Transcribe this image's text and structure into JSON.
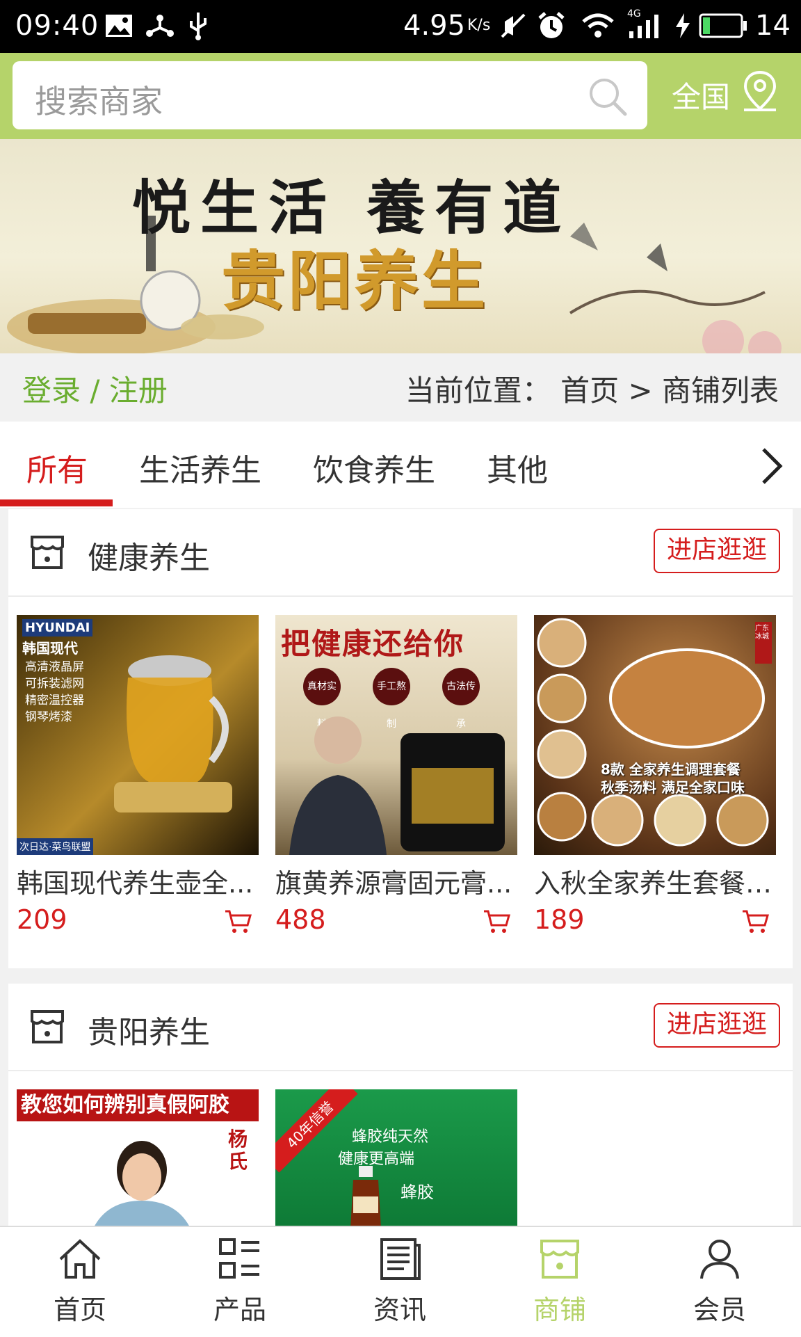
{
  "status_bar": {
    "time": "09:40",
    "net_speed": "4.95",
    "net_unit": "K/s",
    "battery": "14",
    "signal_label": "4G"
  },
  "search": {
    "placeholder": "搜索商家",
    "region": "全国"
  },
  "banner": {
    "line1": "悦生活 養有道",
    "line2": "贵阳养生"
  },
  "login_bar": {
    "login": "登录",
    "separator": "/",
    "register": "注册",
    "breadcrumb": "当前位置： 首页 > 商铺列表"
  },
  "tabs": [
    {
      "label": "所有",
      "active": true
    },
    {
      "label": "生活养生",
      "active": false
    },
    {
      "label": "饮食养生",
      "active": false
    },
    {
      "label": "其他",
      "active": false
    }
  ],
  "stores": [
    {
      "name": "健康养生",
      "visit_label": "进店逛逛",
      "products": [
        {
          "name": "韩国现代养生壶全...",
          "price": "209",
          "image_text": [
            "HYUNDAI",
            "韩国现代",
            "高清液晶屏",
            "可拆装滤网",
            "精密温控器",
            "钢琴烤漆",
            "次日达·菜鸟联盟"
          ]
        },
        {
          "name": "旗黄养源膏固元膏...",
          "price": "488",
          "image_text": [
            "把健康还给你",
            "真材实料",
            "手工熬制",
            "古法传承"
          ]
        },
        {
          "name": "入秋全家养生套餐8...",
          "price": "189",
          "image_text": [
            "8款 全家养生调理套餐",
            "秋季汤料 满足全家口味",
            "广东冰城"
          ]
        }
      ]
    },
    {
      "name": "贵阳养生",
      "visit_label": "进店逛逛",
      "products": [
        {
          "image_text": [
            "教您如何辨别真假阿胶",
            "杨氏"
          ]
        },
        {
          "image_text": [
            "40年信誉",
            "蜂胶纯天然",
            "健康更高端",
            "蜂胶"
          ]
        }
      ]
    }
  ],
  "bottom_nav": [
    {
      "label": "首页",
      "icon": "home-icon",
      "active": false
    },
    {
      "label": "产品",
      "icon": "grid-list-icon",
      "active": false
    },
    {
      "label": "资讯",
      "icon": "news-icon",
      "active": false
    },
    {
      "label": "商铺",
      "icon": "store-icon",
      "active": true
    },
    {
      "label": "会员",
      "icon": "user-icon",
      "active": false
    }
  ],
  "colors": {
    "accent_green": "#b5d36a",
    "brand_red": "#d51d1d",
    "login_green": "#6aad2f"
  }
}
